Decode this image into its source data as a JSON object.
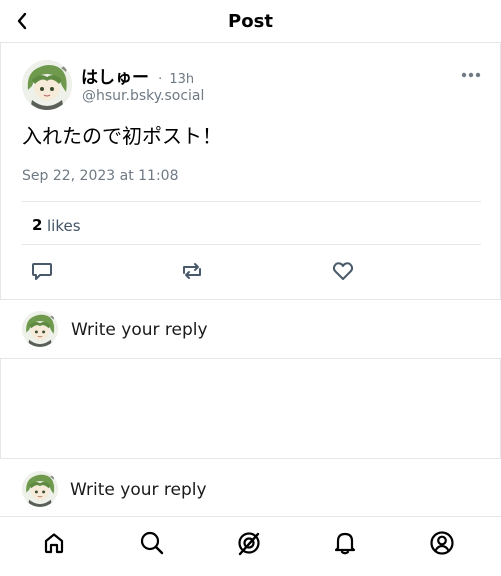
{
  "header": {
    "title": "Post",
    "back_icon": "chevron-left-icon"
  },
  "post": {
    "display_name": "はしゅー",
    "separator": "·",
    "relative_time": "13h",
    "handle": "@hsur.bsky.social",
    "text": "入れたので初ポスト！",
    "timestamp": "Sep 22, 2023 at 11:08",
    "likes_count": "2",
    "likes_label": "likes",
    "actions": [
      "reply-icon",
      "repost-icon",
      "like-icon"
    ],
    "more_icon": "more-horizontal-icon"
  },
  "reply_prompt": "Write your reply",
  "reply_prompt_bottom": "Write your reply",
  "tabbar": {
    "items": [
      "home-icon",
      "search-icon",
      "feeds-icon",
      "notifications-icon",
      "profile-icon"
    ]
  },
  "colors": {
    "border": "#e6e6e6",
    "secondary_text": "#6f7a85",
    "icon": "#4a5a6a",
    "avatar_hair": "#6f9a4e"
  }
}
